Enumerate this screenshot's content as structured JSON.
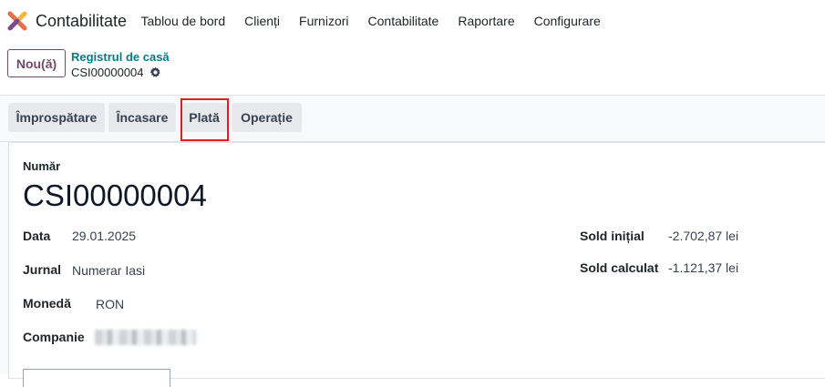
{
  "app": {
    "name": "Contabilitate",
    "logo_icon": "odoo-accounting-logo-icon"
  },
  "menu": [
    {
      "label": "Tablou de bord"
    },
    {
      "label": "Clienți"
    },
    {
      "label": "Furnizori"
    },
    {
      "label": "Contabilitate"
    },
    {
      "label": "Raportare"
    },
    {
      "label": "Configurare"
    }
  ],
  "control": {
    "new_label": "Nou(ă)",
    "breadcrumb_parent": "Registrul de casă",
    "breadcrumb_current": "CSI00000004",
    "settings_icon": "gear-icon"
  },
  "actions": [
    {
      "label": "Împrospătare"
    },
    {
      "label": "Încasare"
    },
    {
      "label": "Plată"
    },
    {
      "label": "Operație"
    }
  ],
  "form": {
    "number_label": "Număr",
    "number_value": "CSI00000004",
    "date_label": "Data",
    "date_value": "29.01.2025",
    "journal_label": "Jurnal",
    "journal_value": "Numerar Iasi",
    "currency_label": "Monedă",
    "currency_value": "RON",
    "company_label": "Companie",
    "opening_label": "Sold inițial",
    "opening_value": "-2.702,87 lei",
    "computed_label": "Sold calculat",
    "computed_value": "-1.121,37 lei"
  },
  "colors": {
    "brand": "#714b67",
    "link": "#017e84",
    "highlight": "#e0201e"
  }
}
